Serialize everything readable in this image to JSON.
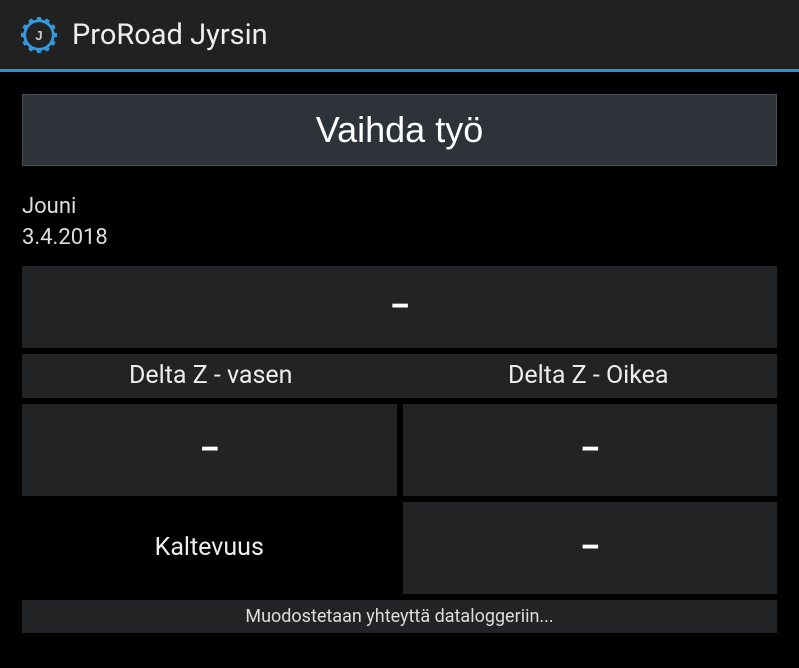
{
  "header": {
    "title": "ProRoad Jyrsin"
  },
  "main": {
    "button_label": "Vaihda työ",
    "user_name": "Jouni",
    "date": "3.4.2018",
    "top_value": "–",
    "delta_left_label": "Delta Z - vasen",
    "delta_right_label": "Delta Z - Oikea",
    "delta_left_value": "–",
    "delta_right_value": "–",
    "kaltevuus_label": "Kaltevuus",
    "kaltevuus_value": "–",
    "status": "Muodostetaan yhteyttä dataloggeriin..."
  }
}
